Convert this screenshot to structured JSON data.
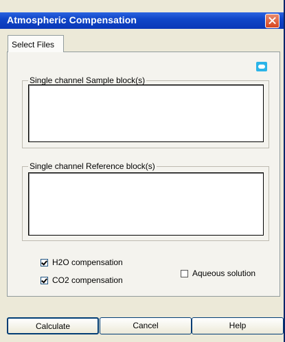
{
  "window": {
    "title": "Atmospheric Compensation"
  },
  "tabs": [
    {
      "label": "Select Files",
      "active": true
    }
  ],
  "groups": {
    "sample": {
      "label": "Single channel Sample block(s)"
    },
    "reference": {
      "label": "Single channel Reference block(s)"
    }
  },
  "options": {
    "h2o": {
      "label": "H2O compensation",
      "checked": true
    },
    "co2": {
      "label": "CO2 compensation",
      "checked": true
    },
    "aqueous": {
      "label": "Aqueous solution",
      "checked": false
    }
  },
  "buttons": {
    "calculate": "Calculate",
    "cancel": "Cancel",
    "help": "Help"
  },
  "colors": {
    "titlebar": "#0a38b8",
    "dialog_bg": "#ece9d8",
    "panel_bg": "#f4f3ee",
    "icon_accent": "#2bb4e8"
  }
}
